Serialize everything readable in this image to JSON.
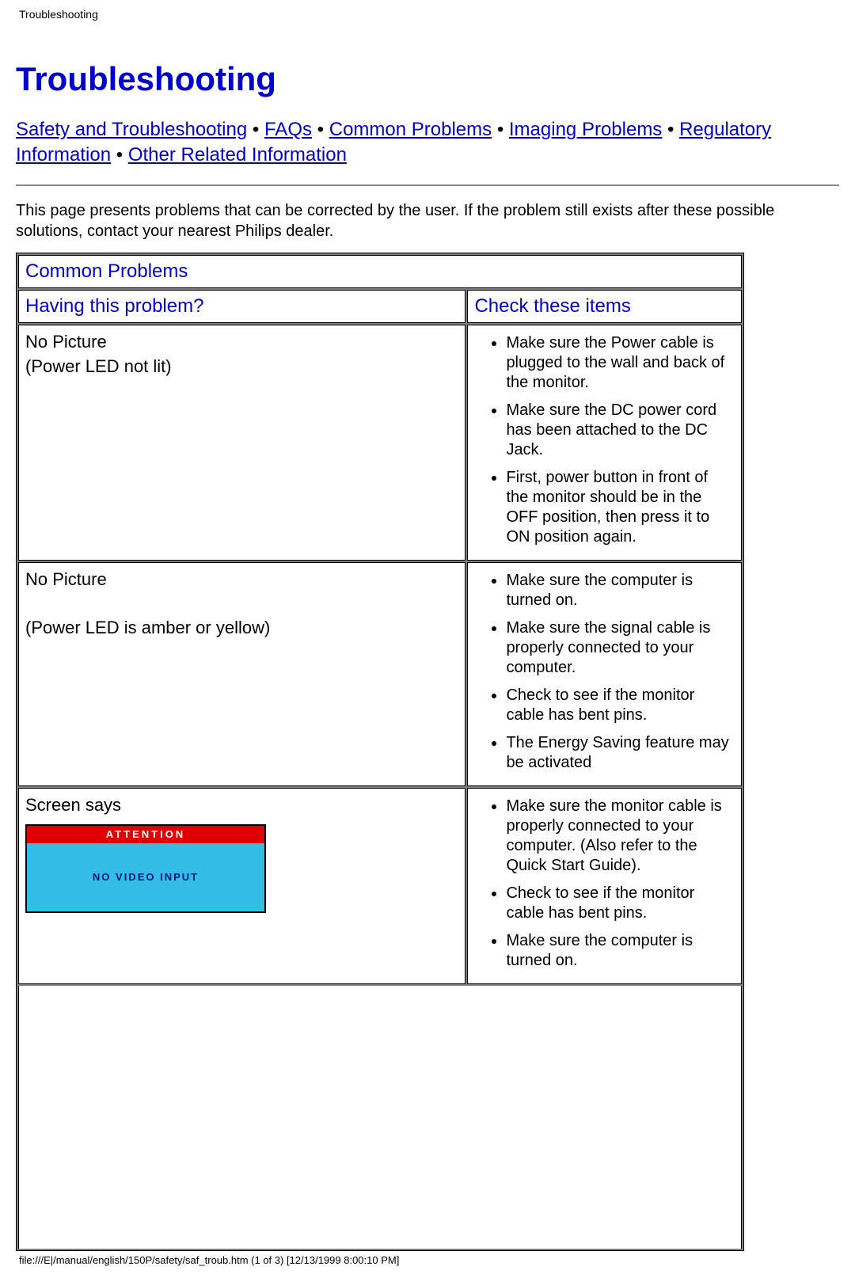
{
  "header": {
    "title": "Troubleshooting"
  },
  "page": {
    "heading": "Troubleshooting",
    "intro": "This page presents problems that can be corrected by the user. If the problem still exists after these possible solutions, contact your nearest Philips dealer."
  },
  "nav": {
    "links": [
      "Safety and Troubleshooting",
      "FAQs",
      "Common Problems",
      "Imaging Problems",
      "Regulatory Information",
      "Other Related Information"
    ],
    "separator": " • "
  },
  "table": {
    "section_title": "Common Problems",
    "col_problem": "Having this problem?",
    "col_check": "Check these items",
    "rows": [
      {
        "problem_line1": "No Picture",
        "problem_line2": "(Power LED not lit)",
        "checks": [
          "Make sure the Power cable is plugged to the wall and back of the monitor.",
          "Make sure the DC power cord has been attached to the DC Jack.",
          "First, power button in front of the monitor should be in the OFF position, then press it to ON position again."
        ]
      },
      {
        "problem_line1": "No Picture",
        "problem_line2": "(Power LED is amber or yellow)",
        "checks": [
          "Make sure the computer is turned on.",
          "Make sure the signal cable is properly connected to your computer.",
          "Check to see if the monitor cable has bent pins.",
          "The Energy Saving feature may be activated"
        ]
      },
      {
        "problem_line1": "Screen says",
        "attention": {
          "title": "ATTENTION",
          "body": "NO VIDEO INPUT"
        },
        "checks": [
          "Make sure the monitor cable is properly connected to your computer. (Also refer to the Quick Start Guide).",
          "Check to see if the monitor cable has bent pins.",
          "Make sure the computer is turned on."
        ]
      }
    ]
  },
  "footer": {
    "text": "file:///E|/manual/english/150P/safety/saf_troub.htm (1 of 3) [12/13/1999 8:00:10 PM]"
  }
}
